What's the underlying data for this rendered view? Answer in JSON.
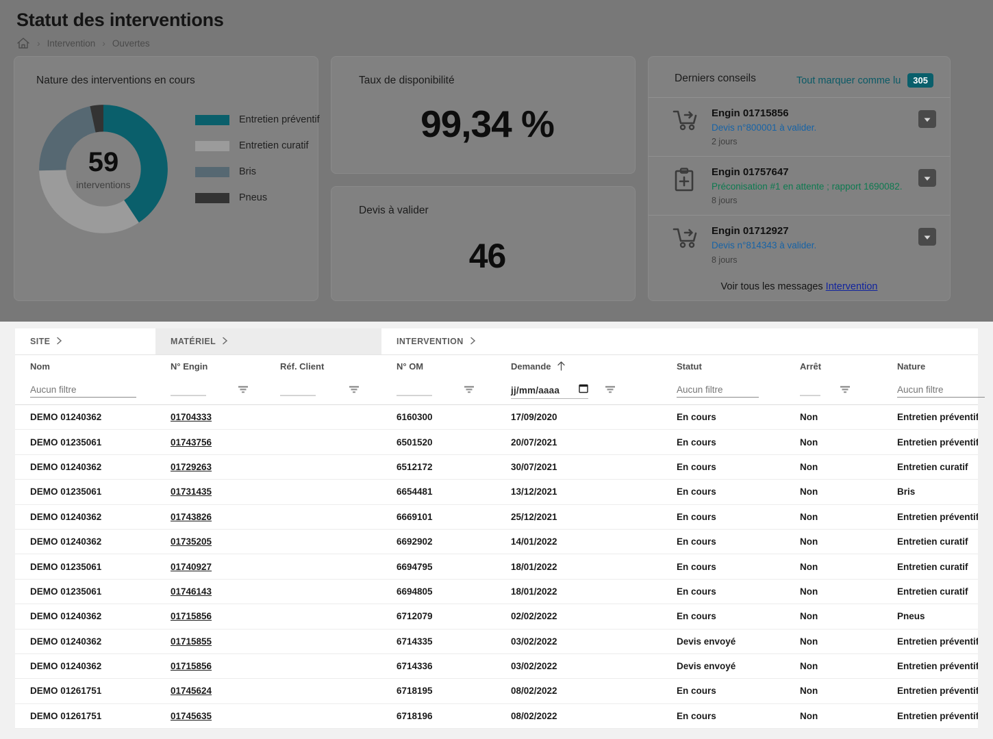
{
  "header": {
    "title": "Statut des interventions",
    "breadcrumb": {
      "home_icon": "home-icon",
      "items": [
        "Intervention",
        "Ouvertes"
      ],
      "separator": "›"
    }
  },
  "cards": {
    "donut": {
      "title": "Nature des interventions en cours",
      "center_value": "59",
      "center_unit": "interventions"
    },
    "availability": {
      "title": "Taux de disponibilité",
      "value": "99,34 %"
    },
    "quotes": {
      "title": "Devis à valider",
      "value": "46"
    }
  },
  "chart_data": {
    "type": "pie",
    "title": "Nature des interventions en cours",
    "total": 59,
    "total_label": "interventions",
    "categories": [
      "Entretien préventif",
      "Entretien curatif",
      "Bris",
      "Pneus"
    ],
    "values": [
      24,
      20,
      13,
      2
    ],
    "percentages": [
      40.7,
      33.9,
      22.0,
      3.4
    ],
    "colors": [
      "#0a5f6b",
      "#9b9b9b",
      "#566872",
      "#333333"
    ],
    "legend_position": "right",
    "hole_ratio": 0.6
  },
  "notifications": {
    "title": "Derniers conseils",
    "mark_all_label": "Tout marquer comme lu",
    "unread_count": "305",
    "footer_text": "Voir tous les messages",
    "footer_link": "Intervention",
    "items": [
      {
        "icon": "cart-arrow-icon",
        "engine": "Engin 01715856",
        "message": "Devis n°800001 à valider.",
        "message_color": "blue",
        "age": "2 jours",
        "expand_icon": "chevron-down-icon"
      },
      {
        "icon": "clipboard-plus-icon",
        "engine": "Engin 01757647",
        "message": "Préconisation #1 en attente ; rapport 1690082.",
        "message_color": "green",
        "age": "8 jours",
        "expand_icon": "chevron-down-icon"
      },
      {
        "icon": "cart-arrow-icon",
        "engine": "Engin 01712927",
        "message": "Devis n°814343 à valider.",
        "message_color": "blue",
        "age": "8 jours",
        "expand_icon": "chevron-down-icon"
      }
    ]
  },
  "table": {
    "group_tabs": [
      {
        "label": "SITE",
        "shaded": false
      },
      {
        "label": "MATÉRIEL",
        "shaded": true
      },
      {
        "label": "INTERVENTION",
        "shaded": false
      }
    ],
    "columns": [
      {
        "key": "nom",
        "label": "Nom"
      },
      {
        "key": "engin",
        "label": "N° Engin"
      },
      {
        "key": "ref",
        "label": "Réf. Client"
      },
      {
        "key": "om",
        "label": "N° OM"
      },
      {
        "key": "demande",
        "label": "Demande",
        "sort": "asc",
        "sort_icon": "arrow-up-icon"
      },
      {
        "key": "statut",
        "label": "Statut"
      },
      {
        "key": "arret",
        "label": "Arrêt"
      },
      {
        "key": "nature",
        "label": "Nature"
      }
    ],
    "filters": {
      "nom_placeholder": "Aucun filtre",
      "date_value": "jj/mm/aaaa",
      "statut_placeholder": "Aucun filtre",
      "nature_placeholder": "Aucun filtre"
    },
    "rows": [
      {
        "nom": "DEMO 01240362",
        "engin": "01704333",
        "ref": "",
        "om": "6160300",
        "demande": "17/09/2020",
        "statut": "En cours",
        "arret": "Non",
        "nature": "Entretien préventif"
      },
      {
        "nom": "DEMO 01235061",
        "engin": "01743756",
        "ref": "",
        "om": "6501520",
        "demande": "20/07/2021",
        "statut": "En cours",
        "arret": "Non",
        "nature": "Entretien préventif"
      },
      {
        "nom": "DEMO 01240362",
        "engin": "01729263",
        "ref": "",
        "om": "6512172",
        "demande": "30/07/2021",
        "statut": "En cours",
        "arret": "Non",
        "nature": "Entretien curatif"
      },
      {
        "nom": "DEMO 01235061",
        "engin": "01731435",
        "ref": "",
        "om": "6654481",
        "demande": "13/12/2021",
        "statut": "En cours",
        "arret": "Non",
        "nature": "Bris"
      },
      {
        "nom": "DEMO 01240362",
        "engin": "01743826",
        "ref": "",
        "om": "6669101",
        "demande": "25/12/2021",
        "statut": "En cours",
        "arret": "Non",
        "nature": "Entretien préventif"
      },
      {
        "nom": "DEMO 01240362",
        "engin": "01735205",
        "ref": "",
        "om": "6692902",
        "demande": "14/01/2022",
        "statut": "En cours",
        "arret": "Non",
        "nature": "Entretien curatif"
      },
      {
        "nom": "DEMO 01235061",
        "engin": "01740927",
        "ref": "",
        "om": "6694795",
        "demande": "18/01/2022",
        "statut": "En cours",
        "arret": "Non",
        "nature": "Entretien curatif"
      },
      {
        "nom": "DEMO 01235061",
        "engin": "01746143",
        "ref": "",
        "om": "6694805",
        "demande": "18/01/2022",
        "statut": "En cours",
        "arret": "Non",
        "nature": "Entretien curatif"
      },
      {
        "nom": "DEMO 01240362",
        "engin": "01715856",
        "ref": "",
        "om": "6712079",
        "demande": "02/02/2022",
        "statut": "En cours",
        "arret": "Non",
        "nature": "Pneus"
      },
      {
        "nom": "DEMO 01240362",
        "engin": "01715855",
        "ref": "",
        "om": "6714335",
        "demande": "03/02/2022",
        "statut": "Devis envoyé",
        "arret": "Non",
        "nature": "Entretien préventif"
      },
      {
        "nom": "DEMO 01240362",
        "engin": "01715856",
        "ref": "",
        "om": "6714336",
        "demande": "03/02/2022",
        "statut": "Devis envoyé",
        "arret": "Non",
        "nature": "Entretien préventif"
      },
      {
        "nom": "DEMO 01261751",
        "engin": "01745624",
        "ref": "",
        "om": "6718195",
        "demande": "08/02/2022",
        "statut": "En cours",
        "arret": "Non",
        "nature": "Entretien préventif"
      },
      {
        "nom": "DEMO 01261751",
        "engin": "01745635",
        "ref": "",
        "om": "6718196",
        "demande": "08/02/2022",
        "statut": "En cours",
        "arret": "Non",
        "nature": "Entretien préventif"
      }
    ]
  }
}
